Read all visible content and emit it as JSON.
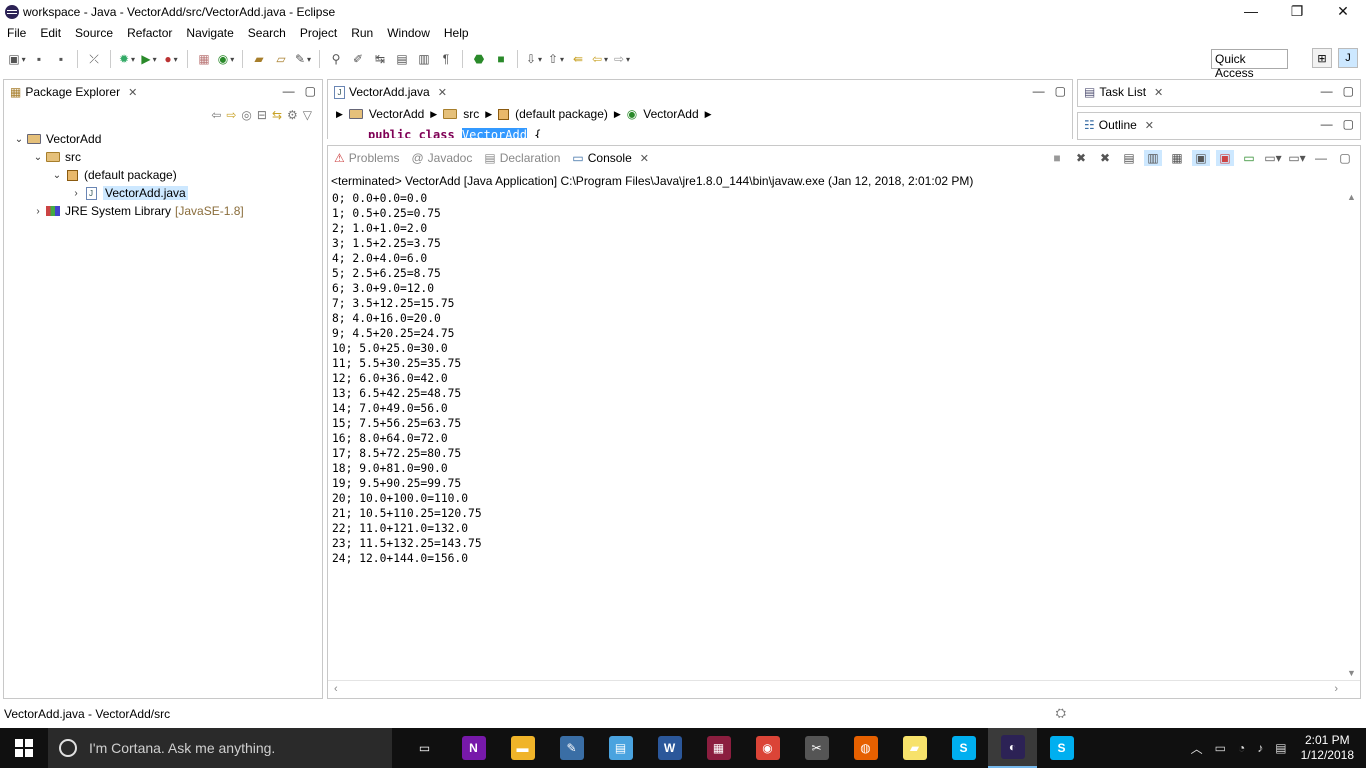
{
  "window": {
    "title": "workspace - Java - VectorAdd/src/VectorAdd.java - Eclipse",
    "minimize": "—",
    "restore": "❐",
    "close": "✕"
  },
  "menu": [
    "File",
    "Edit",
    "Source",
    "Refactor",
    "Navigate",
    "Search",
    "Project",
    "Run",
    "Window",
    "Help"
  ],
  "quick_access": "Quick Access",
  "package_explorer": {
    "tab": "Package Explorer",
    "tree": [
      {
        "label": "VectorAdd",
        "level": 0,
        "expanded": "⌄",
        "icon": "project-icon"
      },
      {
        "label": "src",
        "level": 1,
        "expanded": "⌄",
        "icon": "folder-icon"
      },
      {
        "label": "(default package)",
        "level": 2,
        "expanded": "⌄",
        "icon": "package-icon"
      },
      {
        "label": "VectorAdd.java",
        "level": 3,
        "expanded": "›",
        "icon": "java-file-icon",
        "selected": true
      },
      {
        "label": "JRE System Library",
        "suffix": "[JavaSE-1.8]",
        "level": 1,
        "expanded": "›",
        "icon": "library-icon"
      }
    ]
  },
  "editor": {
    "tab": "VectorAdd.java",
    "breadcrumb": [
      "VectorAdd",
      "src",
      "(default package)",
      "VectorAdd"
    ],
    "code_keyword": "public class ",
    "code_name": "VectorAdd",
    "code_tail": " {"
  },
  "task_list": {
    "tab": "Task List"
  },
  "outline": {
    "tab": "Outline"
  },
  "console": {
    "tabs": [
      "Problems",
      "Javadoc",
      "Declaration",
      "Console"
    ],
    "terminated": "<terminated> VectorAdd [Java Application] C:\\Program Files\\Java\\jre1.8.0_144\\bin\\javaw.exe (Jan 12, 2018, 2:01:02 PM)",
    "lines": [
      "0; 0.0+0.0=0.0",
      "1; 0.5+0.25=0.75",
      "2; 1.0+1.0=2.0",
      "3; 1.5+2.25=3.75",
      "4; 2.0+4.0=6.0",
      "5; 2.5+6.25=8.75",
      "6; 3.0+9.0=12.0",
      "7; 3.5+12.25=15.75",
      "8; 4.0+16.0=20.0",
      "9; 4.5+20.25=24.75",
      "10; 5.0+25.0=30.0",
      "11; 5.5+30.25=35.75",
      "12; 6.0+36.0=42.0",
      "13; 6.5+42.25=48.75",
      "14; 7.0+49.0=56.0",
      "15; 7.5+56.25=63.75",
      "16; 8.0+64.0=72.0",
      "17; 8.5+72.25=80.75",
      "18; 9.0+81.0=90.0",
      "19; 9.5+90.25=99.75",
      "20; 10.0+100.0=110.0",
      "21; 10.5+110.25=120.75",
      "22; 11.0+121.0=132.0",
      "23; 11.5+132.25=143.75",
      "24; 12.0+144.0=156.0"
    ]
  },
  "status": {
    "text": "VectorAdd.java - VectorAdd/src"
  },
  "taskbar": {
    "cortana": "I'm Cortana. Ask me anything.",
    "apps": [
      {
        "name": "task-view",
        "glyph": "▭",
        "color": "#101010"
      },
      {
        "name": "onenote",
        "glyph": "N",
        "color": "#7719aa"
      },
      {
        "name": "file-explorer",
        "glyph": "▬",
        "color": "#f0b429"
      },
      {
        "name": "paint",
        "glyph": "✎",
        "color": "#3a6ea5"
      },
      {
        "name": "notepad",
        "glyph": "▤",
        "color": "#4aa3df"
      },
      {
        "name": "word",
        "glyph": "W",
        "color": "#2b579a"
      },
      {
        "name": "winrar",
        "glyph": "▦",
        "color": "#8b1e3f"
      },
      {
        "name": "chrome",
        "glyph": "◉",
        "color": "#db4437"
      },
      {
        "name": "snipping",
        "glyph": "✂",
        "color": "#555555"
      },
      {
        "name": "firefox",
        "glyph": "◍",
        "color": "#e66000"
      },
      {
        "name": "sticky-notes",
        "glyph": "▰",
        "color": "#f7e26b"
      },
      {
        "name": "skype-business",
        "glyph": "S",
        "color": "#00aff0"
      },
      {
        "name": "eclipse",
        "glyph": "◐",
        "color": "#2c2255"
      },
      {
        "name": "skype",
        "glyph": "S",
        "color": "#00aff0"
      }
    ],
    "time": "2:01 PM",
    "date": "1/12/2018"
  }
}
